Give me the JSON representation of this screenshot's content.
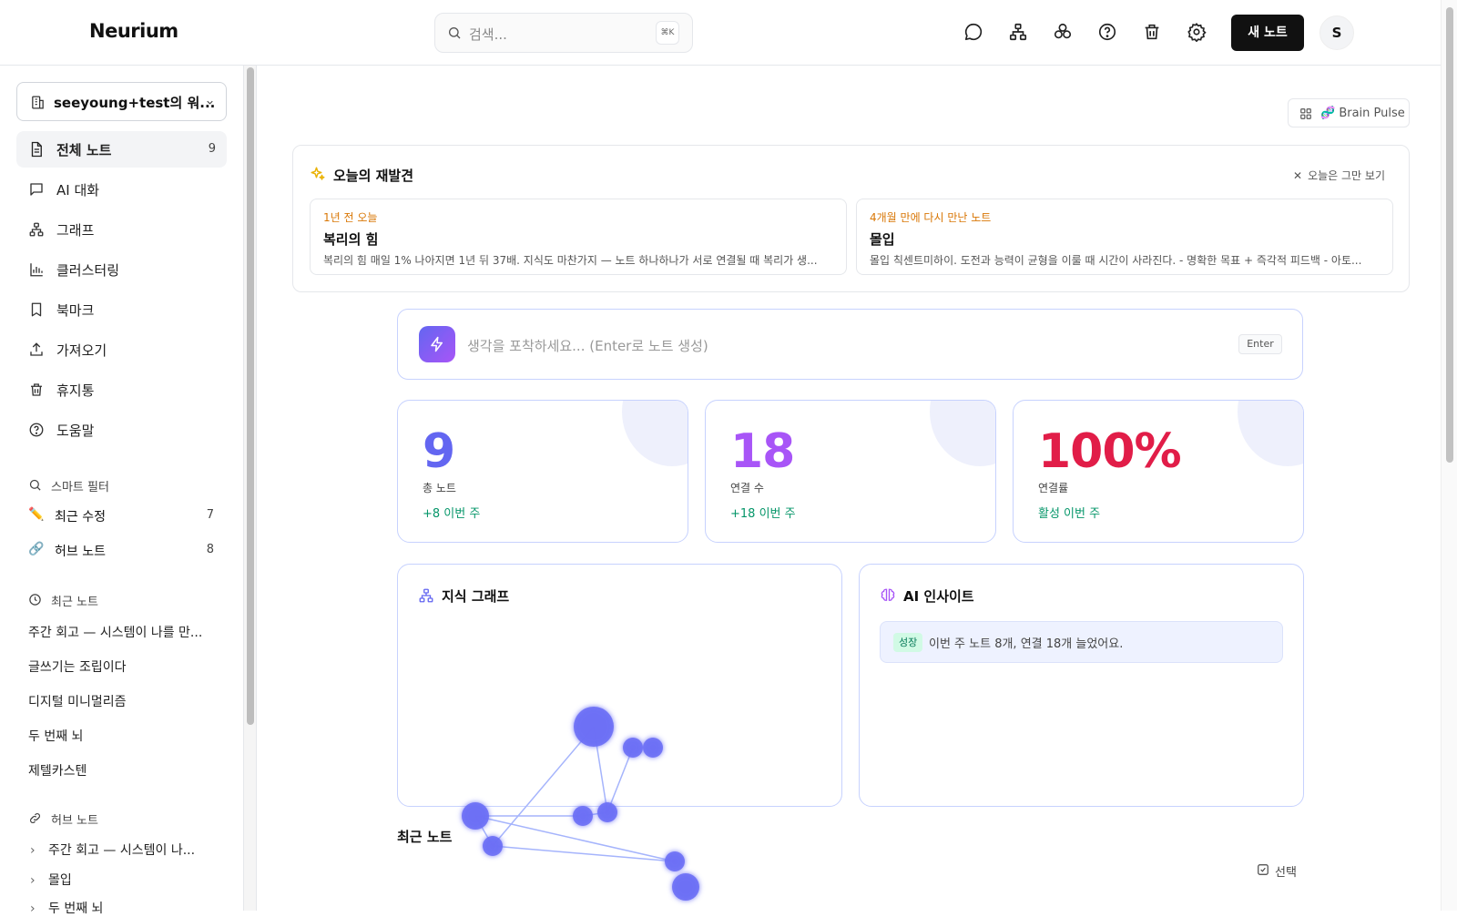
{
  "app": {
    "name": "Neurium"
  },
  "search": {
    "placeholder": "검색...",
    "shortcut": "⌘K"
  },
  "header": {
    "icons": [
      "chat-icon",
      "graph-icon",
      "cluster-icon",
      "help-icon",
      "trash-icon",
      "settings-icon"
    ],
    "new_note_label": "새 노트",
    "avatar_initial": "S"
  },
  "sidebar": {
    "workspace": "seeyoung+test의 워...",
    "nav": [
      {
        "label": "전체 노트",
        "count": "9",
        "icon": "document-icon"
      },
      {
        "label": "AI 대화",
        "icon": "chat-icon"
      },
      {
        "label": "그래프",
        "icon": "graph-icon"
      },
      {
        "label": "클러스터링",
        "icon": "bar-chart-icon"
      },
      {
        "label": "북마크",
        "icon": "bookmark-icon"
      },
      {
        "label": "가져오기",
        "icon": "upload-icon"
      },
      {
        "label": "휴지통",
        "icon": "trash-icon"
      },
      {
        "label": "도움말",
        "icon": "help-icon"
      }
    ],
    "smart_filter": {
      "title": "스마트 필터",
      "items": [
        {
          "label": "최근 수정",
          "count": "7",
          "emoji": "✏️"
        },
        {
          "label": "허브 노트",
          "count": "8",
          "emoji": "🔗"
        }
      ]
    },
    "recent": {
      "title": "최근 노트",
      "items": [
        "주간 회고 — 시스템이 나를 만...",
        "글쓰기는 조립이다",
        "디지털 미니멀리즘",
        "두 번째 뇌",
        "제텔카스텐"
      ]
    },
    "hub": {
      "title": "허브 노트",
      "items": [
        "주간 회고 — 시스템이 나...",
        "몰입",
        "두 번째 뇌"
      ]
    }
  },
  "brain_pulse": {
    "label": "🧬 Brain Pulse"
  },
  "rediscover": {
    "title": "오늘의 재발견",
    "dismiss": "오늘은 그만 보기",
    "cards": [
      {
        "tag": "1년 전 오늘",
        "title": "복리의 힘",
        "body": "복리의 힘 매일 1% 나아지면 1년 뒤 37배. 지식도 마찬가지 — 노트 하나하나가 서로 연결될 때 복리가 생..."
      },
      {
        "tag": "4개월 만에 다시 만난 노트",
        "title": "몰입",
        "body": "몰입 칙센트미하이. 도전과 능력이 균형을 이룰 때 시간이 사라진다. - 명확한 목표 + 즉각적 피드백 - 아토..."
      }
    ]
  },
  "capture": {
    "placeholder": "생각을 포착하세요... (Enter로 노트 생성)",
    "enter_label": "Enter"
  },
  "stats": [
    {
      "value": "9",
      "label": "총 노트",
      "delta": "+8 이번 주",
      "color": "#6366f1"
    },
    {
      "value": "18",
      "label": "연결 수",
      "delta": "+18 이번 주",
      "color": "#a855f7"
    },
    {
      "value": "100%",
      "label": "연결률",
      "delta": "활성 이번 주",
      "color": "#e11d48"
    }
  ],
  "knowledge_graph": {
    "title": "지식 그래프",
    "node_color": "#6b6ff5",
    "edge_color": "#a5b4fc"
  },
  "ai_insight": {
    "title": "AI 인사이트",
    "badge": "성장",
    "text": "이번 주 노트 8개, 연결 18개 늘었어요."
  },
  "recent_notes": {
    "heading": "최근 노트",
    "select_label": "선택"
  }
}
